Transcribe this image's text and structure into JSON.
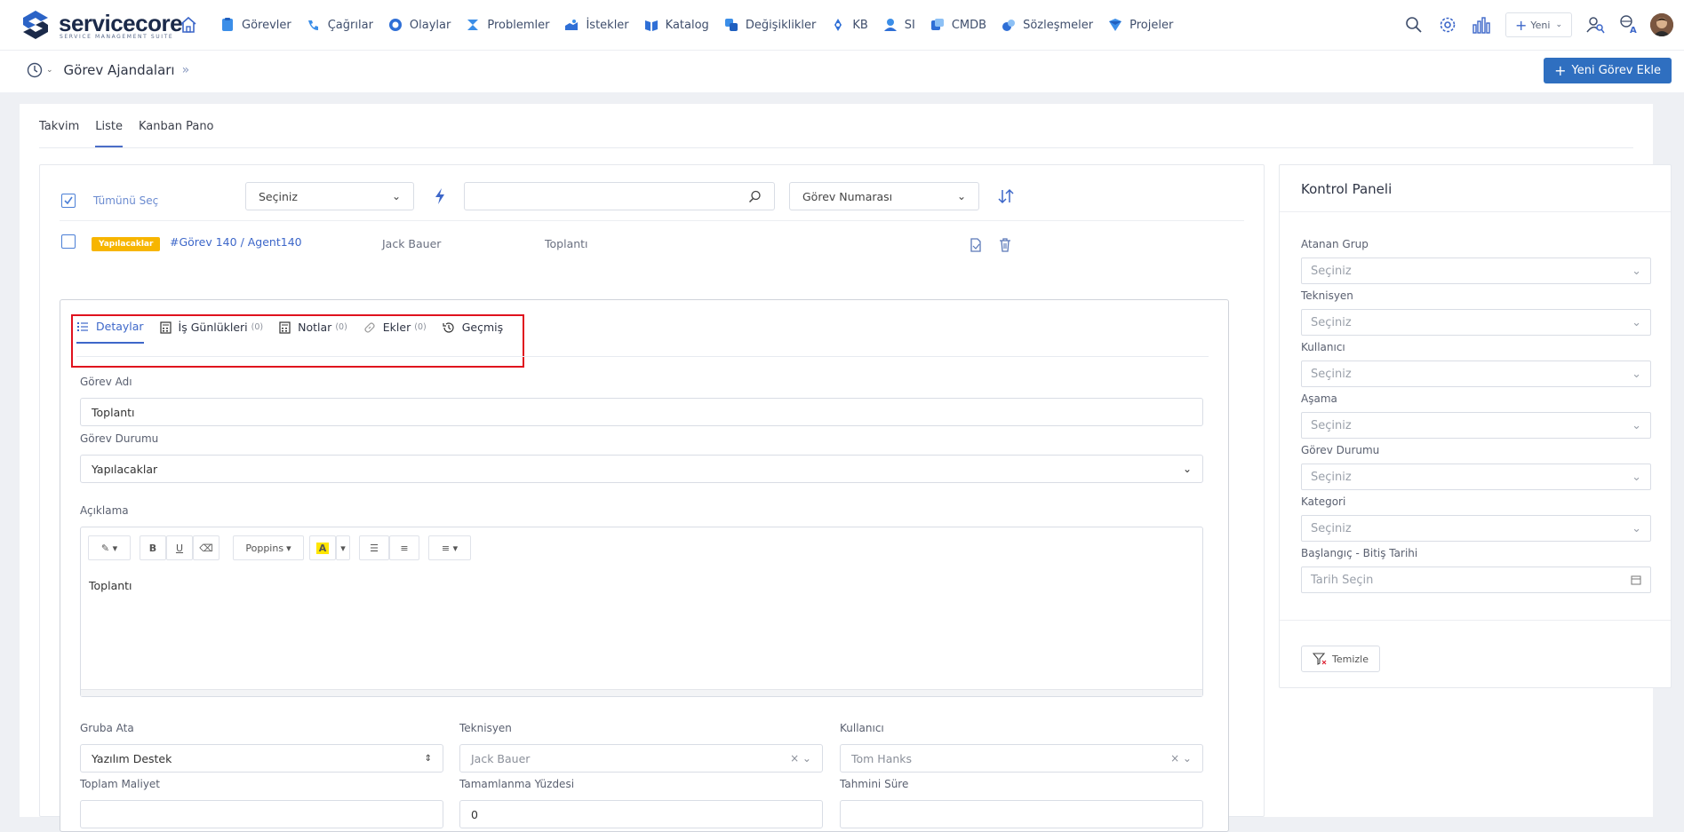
{
  "brand": {
    "name": "servicecore",
    "tagline": "SERVICE MANAGEMENT SUITE"
  },
  "nav": [
    {
      "label": "Görevler",
      "icon": "tasks-icon"
    },
    {
      "label": "Çağrılar",
      "icon": "calls-icon"
    },
    {
      "label": "Olaylar",
      "icon": "incidents-icon"
    },
    {
      "label": "Problemler",
      "icon": "problems-icon"
    },
    {
      "label": "İstekler",
      "icon": "requests-icon"
    },
    {
      "label": "Katalog",
      "icon": "catalog-icon"
    },
    {
      "label": "Değişiklikler",
      "icon": "changes-icon"
    },
    {
      "label": "KB",
      "icon": "kb-icon"
    },
    {
      "label": "SI",
      "icon": "si-icon"
    },
    {
      "label": "CMDB",
      "icon": "cmdb-icon"
    },
    {
      "label": "Sözleşmeler",
      "icon": "contracts-icon"
    },
    {
      "label": "Projeler",
      "icon": "projects-icon"
    }
  ],
  "header": {
    "new_label": "Yeni"
  },
  "page": {
    "title": "Görev Ajandaları",
    "add_button": "Yeni Görev Ekle"
  },
  "view_tabs": [
    "Takvim",
    "Liste",
    "Kanban Pano"
  ],
  "list": {
    "select_all": "Tümünü Seç",
    "filter_select": "Seçiniz",
    "search_value": "",
    "sort_select": "Görev Numarası",
    "row": {
      "status": "Yapılacaklar",
      "title": "#Görev 140 / Agent140",
      "technician": "Jack Bauer",
      "name": "Toplantı"
    }
  },
  "detail": {
    "tabs": [
      {
        "label": "Detaylar",
        "count": ""
      },
      {
        "label": "İş Günlükleri",
        "count": "(0)"
      },
      {
        "label": "Notlar",
        "count": "(0)"
      },
      {
        "label": "Ekler",
        "count": "(0)"
      },
      {
        "label": "Geçmiş",
        "count": ""
      }
    ],
    "task_name_label": "Görev Adı",
    "task_name_value": "Toplantı",
    "status_label": "Görev Durumu",
    "status_value": "Yapılacaklar",
    "description_label": "Açıklama",
    "description_value": "Toplantı",
    "font_name": "Poppins",
    "group_label": "Gruba Ata",
    "group_value": "Yazılım Destek",
    "technician_label": "Teknisyen",
    "technician_value": "Jack Bauer",
    "user_label": "Kullanıcı",
    "user_value": "Tom Hanks",
    "cost_label": "Toplam Maliyet",
    "cost_value": "",
    "completion_label": "Tamamlanma Yüzdesi",
    "completion_value": "0",
    "estimate_label": "Tahmini Süre",
    "estimate_value": ""
  },
  "panel": {
    "title": "Kontrol Paneli",
    "filters": [
      {
        "label": "Atanan Grup",
        "placeholder": "Seçiniz"
      },
      {
        "label": "Teknisyen",
        "placeholder": "Seçiniz"
      },
      {
        "label": "Kullanıcı",
        "placeholder": "Seçiniz"
      },
      {
        "label": "Aşama",
        "placeholder": "Seçiniz"
      },
      {
        "label": "Görev Durumu",
        "placeholder": "Seçiniz"
      },
      {
        "label": "Kategori",
        "placeholder": "Seçiniz"
      }
    ],
    "date_label": "Başlangıç - Bitiş Tarihi",
    "date_placeholder": "Tarih Seçin",
    "clear_button": "Temizle"
  },
  "colors": {
    "accent": "#3d67c9",
    "primary_button": "#2f6fc0",
    "status_badge": "#f7b500",
    "highlight_box": "#e0121e"
  }
}
